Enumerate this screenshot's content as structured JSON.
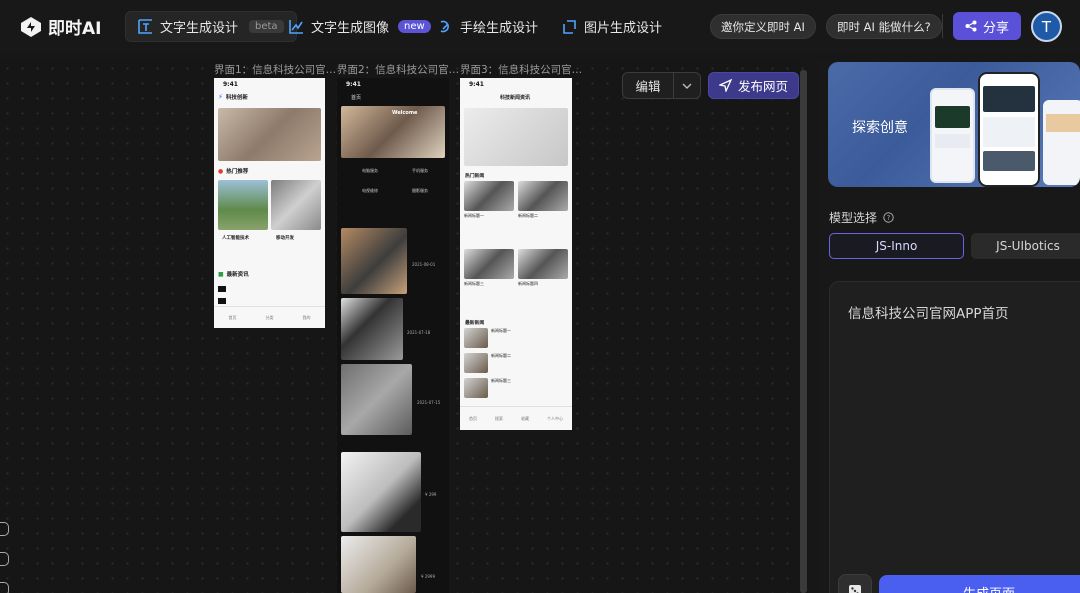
{
  "app": {
    "name": "即时AI"
  },
  "tabs": [
    {
      "label": "文字生成设计",
      "badge": "beta"
    },
    {
      "label": "文字生成图像",
      "badge": "new"
    },
    {
      "label": "手绘生成设计",
      "badge": ""
    },
    {
      "label": "图片生成设计",
      "badge": ""
    }
  ],
  "header": {
    "pill_invite": "邀你定义即时 AI",
    "pill_what": "即时 AI 能做什么?",
    "share_label": "分享",
    "avatar_initial": "T"
  },
  "canvas": {
    "frames": [
      {
        "label": "界面1：信息科技公司官…",
        "status_time": "9:41",
        "app_title": "科技创新",
        "section_hot": "热门推荐",
        "card1": "人工智能技术",
        "card2": "移动开发",
        "section_news": "最新资讯",
        "nav": [
          "首页",
          "分类",
          "我的"
        ]
      },
      {
        "label": "界面2：信息科技公司官…",
        "status_time": "9:41",
        "app_title": "首页",
        "hero_text": "Welcome",
        "cats": [
          "电脑服务",
          "手机服务",
          "电视维修",
          "摄影服务"
        ],
        "dates": [
          "2021-08-01",
          "2021-07-18",
          "2021-07-15",
          "¥ 299",
          "¥ 2999"
        ]
      },
      {
        "label": "界面3：信息科技公司官…",
        "status_time": "9:41",
        "app_title": "科技新闻资讯",
        "section_hot": "热门新闻",
        "news_titles": [
          "新闻标题一",
          "新闻标题二",
          "新闻标题三",
          "新闻标题四"
        ],
        "section_latest": "最新新闻",
        "latest_titles": [
          "新闻标题一",
          "新闻标题二",
          "新闻标题三"
        ],
        "nav": [
          "首页",
          "搜索",
          "收藏",
          "个人中心"
        ]
      }
    ],
    "edit_label": "编辑",
    "publish_label": "发布网页"
  },
  "right_panel": {
    "banner_text": "探索创意",
    "model_label": "模型选择",
    "models": [
      "JS-Inno",
      "JS-UIbotics"
    ],
    "selected_model": "JS-Inno",
    "prompt": "信息科技公司官网APP首页",
    "generate_label": "生成页面"
  },
  "colors": {
    "accent": "#5a51d8",
    "generate": "#4a5ef0",
    "background": "#171717"
  }
}
